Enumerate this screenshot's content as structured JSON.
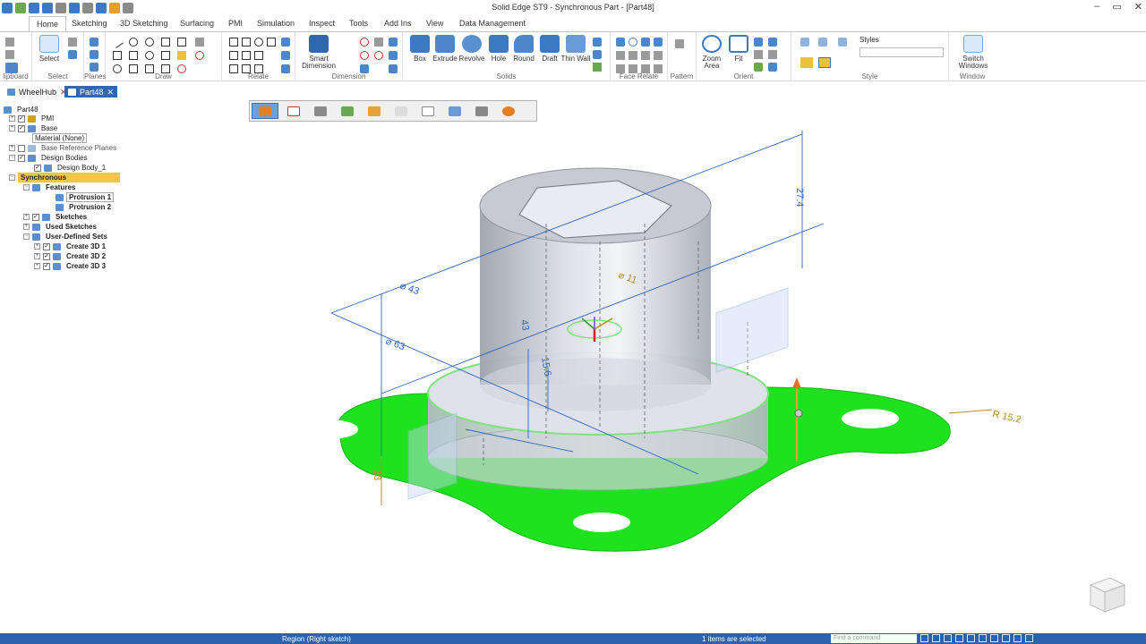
{
  "window": {
    "title": "Solid Edge ST9 - Synchronous Part - [Part48]",
    "controls": [
      "–",
      "▭",
      "✕"
    ]
  },
  "ribbon_tabs": [
    "Home",
    "Sketching",
    "3D Sketching",
    "Surfacing",
    "PMI",
    "Simulation",
    "Inspect",
    "Tools",
    "Add Ins",
    "View",
    "Data Management"
  ],
  "active_ribbon_tab": "Home",
  "ribbon": {
    "groups": {
      "clipboard": "lipboard",
      "select": "Select",
      "planes": "Planes",
      "draw": "Draw",
      "relate": "Relate",
      "dimension": "Dimension",
      "solids": "Solids",
      "face_relate": "Face Relate",
      "pattern": "Pattern",
      "orient": "Orient",
      "style": "Style",
      "window": "Window"
    },
    "buttons": {
      "select": "Select",
      "smart_dimension": "Smart Dimension",
      "box": "Box",
      "extrude": "Extrude",
      "revolve": "Revolve",
      "hole": "Hole",
      "round": "Round",
      "draft": "Draft",
      "thin_wall": "Thin Wall",
      "zoom_area": "Zoom Area",
      "fit": "Fit",
      "styles": "Styles",
      "switch_windows": "Switch Windows"
    }
  },
  "doc_tabs": [
    {
      "label": "WheelHub",
      "active": false
    },
    {
      "label": "Part48",
      "active": true
    }
  ],
  "tree": {
    "root": "Part48",
    "items": {
      "pmi": "PMI",
      "base": "Base",
      "material": "Material (None)",
      "base_ref_planes": "Base Reference Planes",
      "design_bodies": "Design Bodies",
      "design_body_1": "Design Body_1",
      "synchronous": "Synchronous",
      "features": "Features",
      "protrusion_1": "Protrusion 1",
      "protrusion_2": "Protrusion 2",
      "sketches": "Sketches",
      "used_sketches": "Used Sketches",
      "user_defined_sets": "User-Defined Sets",
      "create_3d_1": "Create 3D 1",
      "create_3d_2": "Create 3D 2",
      "create_3d_3": "Create 3D 3"
    }
  },
  "viewport": {
    "dimensions": {
      "d_top_height": "27.4",
      "d_outer_dia": "⌀ 43",
      "d_flange_dia": "⌀ 63",
      "d_hex": "⌀ 11",
      "d_inner_43": "43",
      "d_inner_156": "15.6",
      "d_base_thk": "13",
      "d_radius": "R 15.2"
    },
    "colors": {
      "region_fill": "#1ee21e",
      "body": "#c9ccd6",
      "dimension": "#2e66c4",
      "dimension_accent": "#b88b2a"
    }
  },
  "status": {
    "prompt": "Region (Right sketch)",
    "selection": "1 items are selected",
    "find_placeholder": "Find a command"
  },
  "colors": {
    "status_bar": "#2c62ad",
    "active_tab": "#2f67b3",
    "highlight": "#f5c543"
  }
}
